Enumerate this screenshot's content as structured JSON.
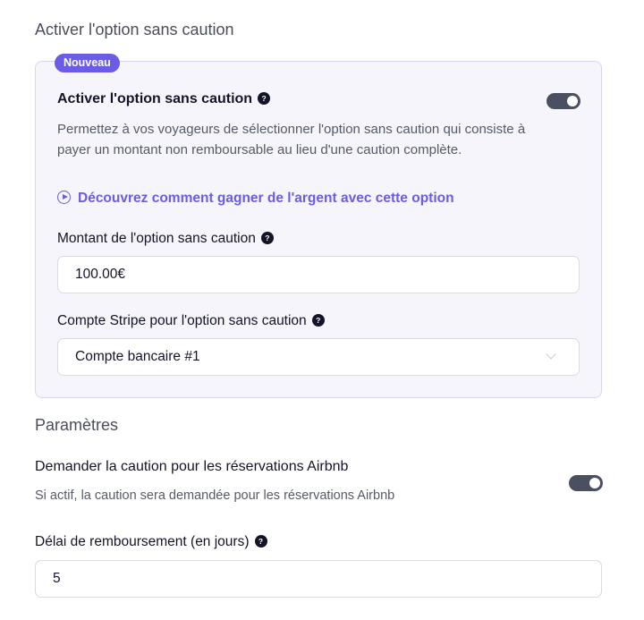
{
  "section_title": "Activer l'option sans caution",
  "card": {
    "badge": "Nouveau",
    "title": "Activer l'option sans caution",
    "help_glyph": "?",
    "toggle_on": true,
    "description": "Permettez à vos voyageurs de sélectionner l'option sans caution qui consiste à payer un montant non remboursable au lieu d'une caution complète.",
    "learn_link": "Découvrez comment gagner de l'argent avec cette option",
    "amount_label": "Montant de l'option sans caution",
    "amount_value": "100.00€",
    "stripe_label": "Compte Stripe pour l'option sans caution",
    "stripe_value": "Compte bancaire #1"
  },
  "params": {
    "title": "Paramètres",
    "airbnb_label": "Demander la caution pour les réservations Airbnb",
    "airbnb_desc": "Si actif, la caution sera demandée pour les réservations Airbnb",
    "airbnb_toggle_on": true,
    "refund_label": "Délai de remboursement (en jours)",
    "refund_value": "5"
  },
  "colors": {
    "accent": "#6b5ce7",
    "toggle": "#4b5061",
    "card_bg": "#f5f5fb",
    "card_border": "#d6d4f2"
  }
}
